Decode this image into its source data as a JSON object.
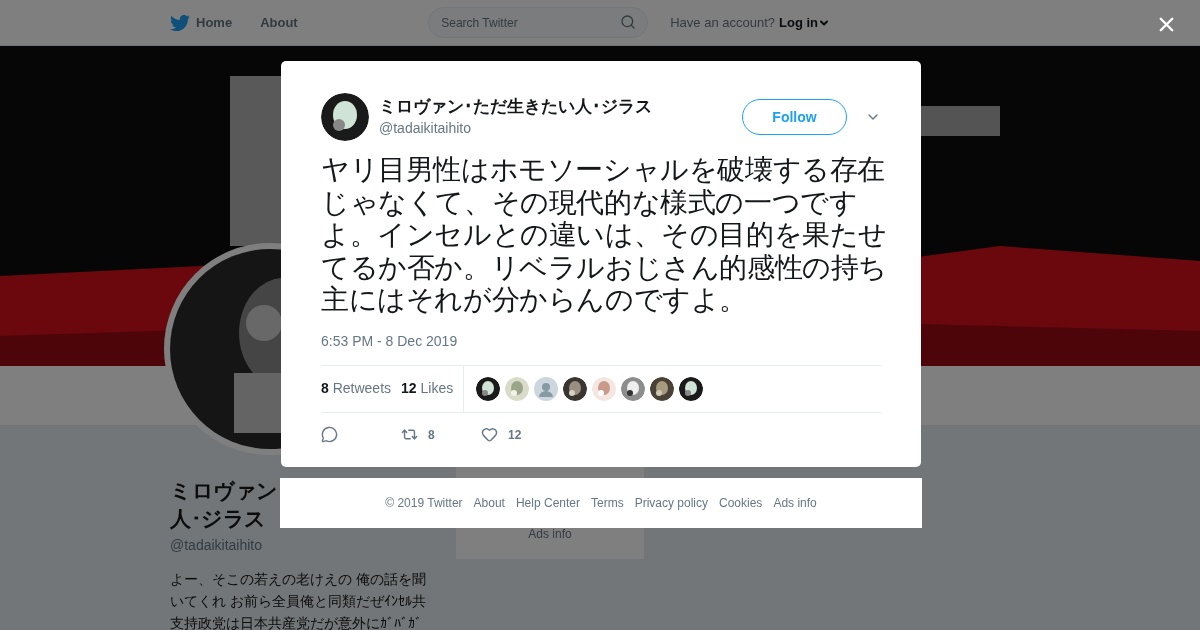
{
  "nav": {
    "items": [
      {
        "label": "Home",
        "kind": "home"
      },
      {
        "label": "About",
        "kind": "plain"
      }
    ],
    "search": {
      "placeholder": "Search Twitter"
    },
    "account_prompt": "Have an account?",
    "login": "Log in"
  },
  "profile": {
    "name_lines": [
      "ミロヴァン",
      "人･ジラス"
    ],
    "handle": "@tadaikitaihito",
    "bio_lines": [
      "よー、そこの若えの老けえの 俺の話を聞",
      "いてくれ お前ら全員俺と同類だぜｲﾝｾﾙ共",
      "支持政党は日本共産党だが意外にｶﾞﾊﾞｶﾞ"
    ]
  },
  "sidebar": {
    "link": "Ads info"
  },
  "tweet": {
    "author": "ミロヴァン･ただ生きたい人･ジラス",
    "handle": "@tadaikitaihito",
    "follow": "Follow",
    "text": "ヤリ目男性はホモソーシャルを破壊する存在じゃなくて、その現代的な様式の一つですよ。インセルとの違いは、その目的を果たせてるか否か。リベラルおじさん的感性の持ち主にはそれが分からんのですよ。",
    "timestamp": "6:53 PM - 8 Dec 2019",
    "retweets": {
      "count": "8",
      "label": "Retweets"
    },
    "likes": {
      "count": "12",
      "label": "Likes"
    },
    "likers": [
      {
        "kind": "picture"
      },
      {
        "kind": "picture"
      },
      {
        "kind": "default"
      },
      {
        "kind": "picture"
      },
      {
        "kind": "picture"
      },
      {
        "kind": "picture"
      },
      {
        "kind": "picture"
      },
      {
        "kind": "picture"
      }
    ],
    "actions": [
      {
        "kind": "reply"
      },
      {
        "kind": "retweet",
        "count": "8"
      },
      {
        "kind": "like",
        "count": "12"
      }
    ]
  },
  "footer": {
    "links": [
      "© 2019 Twitter",
      "About",
      "Help Center",
      "Terms",
      "Privacy policy",
      "Cookies",
      "Ads info"
    ]
  }
}
